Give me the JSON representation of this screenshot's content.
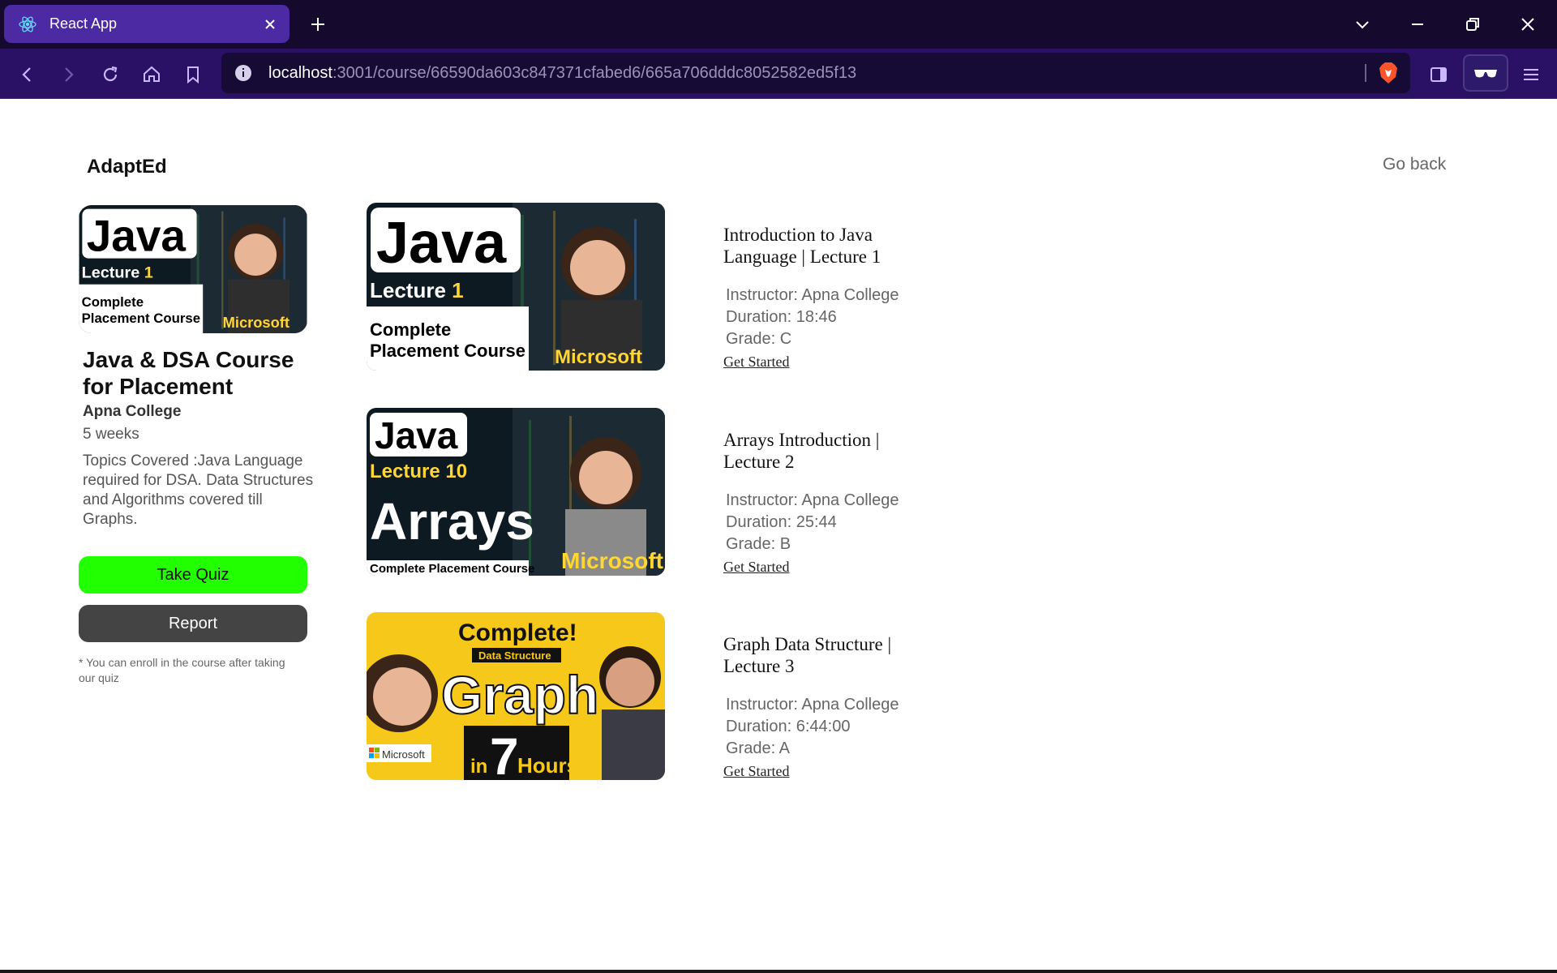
{
  "browser": {
    "tab_title": "React App",
    "url_host": "localhost",
    "url_rest": ":3001/course/66590da603c847371cfabed6/665a706dddc8052582ed5f13",
    "colors": {
      "tabbar": "#150a2e",
      "active_tab": "#4b2aa3",
      "toolbar": "#2a1165"
    }
  },
  "header": {
    "brand": "AdaptEd",
    "go_back": "Go back"
  },
  "course": {
    "title": "Java & DSA Course for Placement",
    "instructor": "Apna College",
    "duration": "5 weeks",
    "topics": "Topics Covered :Java Language required for DSA. Data Structures and Algorithms covered till Graphs.",
    "thumb": {
      "big": "Java",
      "lecture": "Lecture ",
      "num": "1",
      "line1": "Complete",
      "line2": "Placement Course",
      "brand": "Microsoft"
    }
  },
  "actions": {
    "quiz": "Take Quiz",
    "report": "Report",
    "note": "* You can enroll in the course after taking our quiz",
    "quiz_color": "#22ff00",
    "report_color": "#444444"
  },
  "lectures": [
    {
      "title": "Introduction to Java Language | Lecture 1",
      "instructor": "Instructor: Apna College",
      "duration": "Duration: 18:46",
      "grade": "Grade: C",
      "action": "Get Started",
      "thumb": {
        "big": "Java",
        "lecture": "Lecture ",
        "num": "1",
        "line1": "Complete",
        "line2": "Placement Course",
        "brand": "Microsoft"
      }
    },
    {
      "title": "Arrays Introduction | Lecture 2",
      "instructor": "Instructor: Apna College",
      "duration": "Duration: 25:44",
      "grade": "Grade: B",
      "action": "Get Started",
      "thumb": {
        "big": "Java",
        "lecture": "Lecture ",
        "num": "10",
        "topic": "Arrays",
        "line1": "Complete Placement Course",
        "brand": "Microsoft"
      }
    },
    {
      "title": "Graph Data Structure | Lecture 3",
      "instructor": "Instructor: Apna College",
      "duration": "Duration: 6:44:00",
      "grade": "Grade: A",
      "action": "Get Started",
      "thumb": {
        "top": "Complete!",
        "sub": "Data Structure",
        "big": "Graph",
        "in": "in",
        "num": "7",
        "unit": "Hours",
        "brand": "Microsoft"
      }
    }
  ]
}
